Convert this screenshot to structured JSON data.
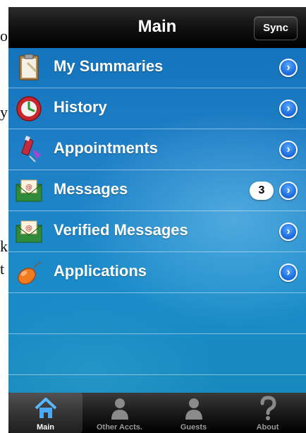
{
  "background_text": [
    "o",
    "y",
    "k",
    "t"
  ],
  "navbar": {
    "title": "Main",
    "sync_label": "Sync"
  },
  "menu": [
    {
      "label": "My Summaries",
      "icon": "clipboard-icon"
    },
    {
      "label": "History",
      "icon": "clock-icon"
    },
    {
      "label": "Appointments",
      "icon": "syringe-icon"
    },
    {
      "label": "Messages",
      "icon": "envelope-icon",
      "badge": "3"
    },
    {
      "label": "Verified Messages",
      "icon": "envelope-icon"
    },
    {
      "label": "Applications",
      "icon": "mouse-icon"
    }
  ],
  "tabs": [
    {
      "label": "Main",
      "icon": "home-icon",
      "active": true
    },
    {
      "label": "Other Accts.",
      "icon": "person-icon"
    },
    {
      "label": "Guests",
      "icon": "person-icon"
    },
    {
      "label": "About",
      "icon": "question-icon"
    }
  ],
  "colors": {
    "accent": "#1f6fe0",
    "background": "#1a80c4",
    "bar": "#000000"
  }
}
